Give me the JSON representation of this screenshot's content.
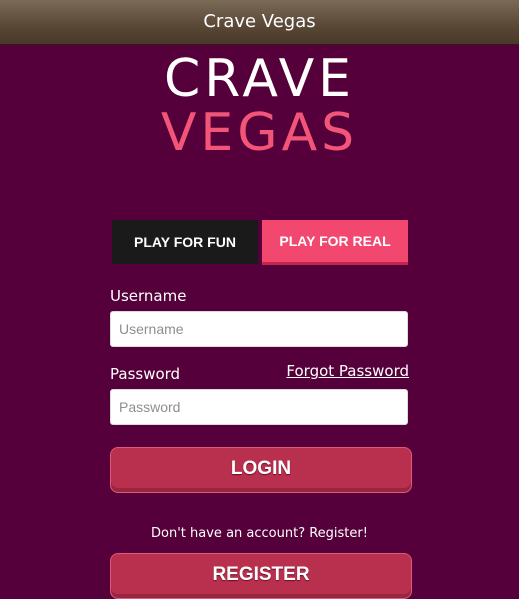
{
  "titlebar": {
    "title": "Crave Vegas"
  },
  "logo": {
    "line1": "CRAVE",
    "line2": "VEGAS"
  },
  "tabs": {
    "fun": "PLAY FOR FUN",
    "real": "PLAY FOR REAL"
  },
  "form": {
    "username_label": "Username",
    "username_placeholder": "Username",
    "password_label": "Password",
    "password_placeholder": "Password",
    "forgot_link": "Forgot Password",
    "login_button": "LOGIN"
  },
  "register": {
    "prompt": "Don't have an account? Register!",
    "button": "REGISTER"
  },
  "colors": {
    "background": "#55003a",
    "accent": "#f2476f",
    "button": "#b8304e"
  }
}
